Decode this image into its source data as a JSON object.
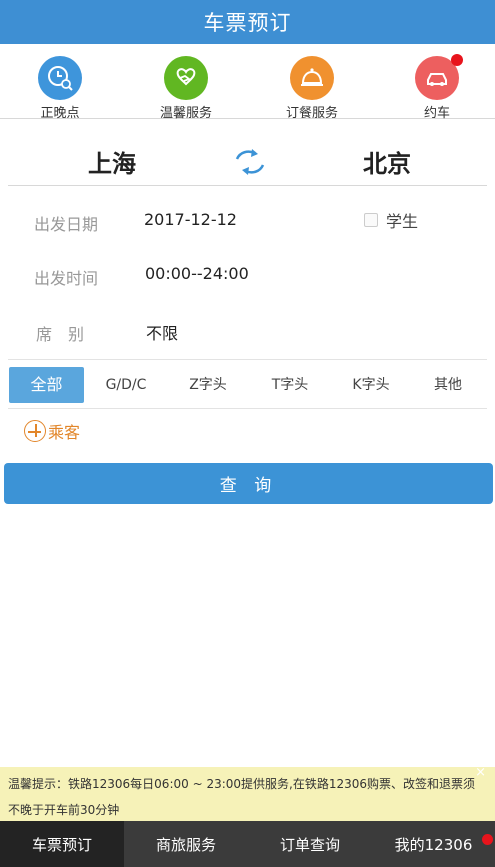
{
  "header": {
    "title": "车票预订"
  },
  "services": [
    {
      "label": "正晚点",
      "icon": "clock-search-icon",
      "color": "#3e95db"
    },
    {
      "label": "温馨服务",
      "icon": "handshake-heart-icon",
      "color": "#61b722"
    },
    {
      "label": "订餐服务",
      "icon": "dish-cloche-icon",
      "color": "#f0912f"
    },
    {
      "label": "约车",
      "icon": "car-icon",
      "color": "#ed5f5f",
      "badge": true
    }
  ],
  "route": {
    "from": "上海",
    "to": "北京",
    "swap_icon": "swap-arrows-icon"
  },
  "form": {
    "date_label": "出发日期",
    "date_value": "2017-12-12",
    "time_label": "出发时间",
    "time_value": "00:00--24:00",
    "seat_label": "席　别",
    "seat_value": "不限",
    "student_label": "学生"
  },
  "filters": [
    {
      "label": "全部",
      "active": true
    },
    {
      "label": "G/D/C"
    },
    {
      "label": "Z字头"
    },
    {
      "label": "T字头"
    },
    {
      "label": "K字头"
    },
    {
      "label": "其他"
    }
  ],
  "passenger": {
    "label": "乘客",
    "icon": "plus-circle-icon"
  },
  "query_button": "查 询",
  "notice": {
    "line1": "温馨提示：铁路12306每日06:00 ~ 23:00提供服务,在铁路12306购票、改签和退票须",
    "line2": "不晚于开车前30分钟",
    "close": "×"
  },
  "tabs": [
    {
      "label": "车票预订",
      "active": true
    },
    {
      "label": "商旅服务"
    },
    {
      "label": "订单查询"
    },
    {
      "label": "我的12306",
      "badge": true
    }
  ],
  "colors": {
    "primary": "#3e8fd3",
    "accent": "#e2862a",
    "badge": "#e8141c"
  }
}
